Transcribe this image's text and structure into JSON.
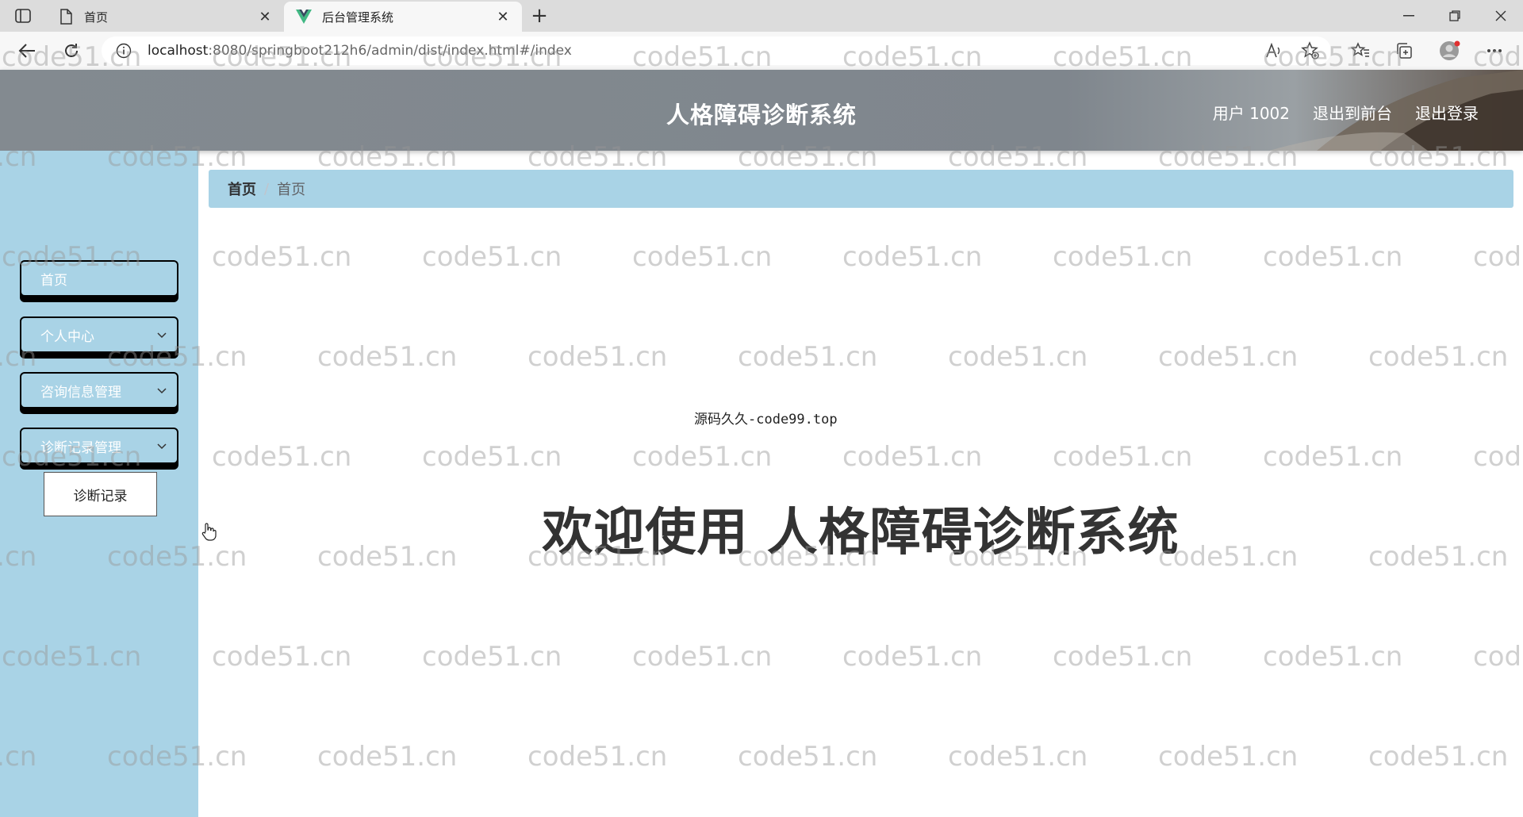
{
  "browser": {
    "tabs": [
      {
        "title": "首页",
        "icon": "page-icon"
      },
      {
        "title": "后台管理系统",
        "icon": "vue-logo-icon",
        "active": true
      }
    ],
    "url_host": "localhost",
    "url_rest": ":8080/springboot212h6/admin/dist/index.html#/index"
  },
  "header": {
    "title": "人格障碍诊断系统",
    "user_label": "用户 1002",
    "back_front_label": "退出到前台",
    "logout_label": "退出登录"
  },
  "sidebar": {
    "items": [
      {
        "label": "首页"
      },
      {
        "label": "个人中心",
        "expandable": true
      },
      {
        "label": "咨询信息管理",
        "expandable": true
      },
      {
        "label": "诊断记录管理",
        "expandable": true
      }
    ],
    "submenu": {
      "label": "诊断记录"
    }
  },
  "breadcrumb": {
    "items": [
      "首页",
      "首页"
    ]
  },
  "main": {
    "source_note": "源码久久-code99.top",
    "welcome": "欢迎使用 人格障碍诊断系统"
  },
  "watermark": {
    "text": "code51.cn"
  },
  "colors": {
    "header": "#838a90",
    "sidebar": "#a9d3e6",
    "breadcrumb": "#a9d3e6"
  }
}
